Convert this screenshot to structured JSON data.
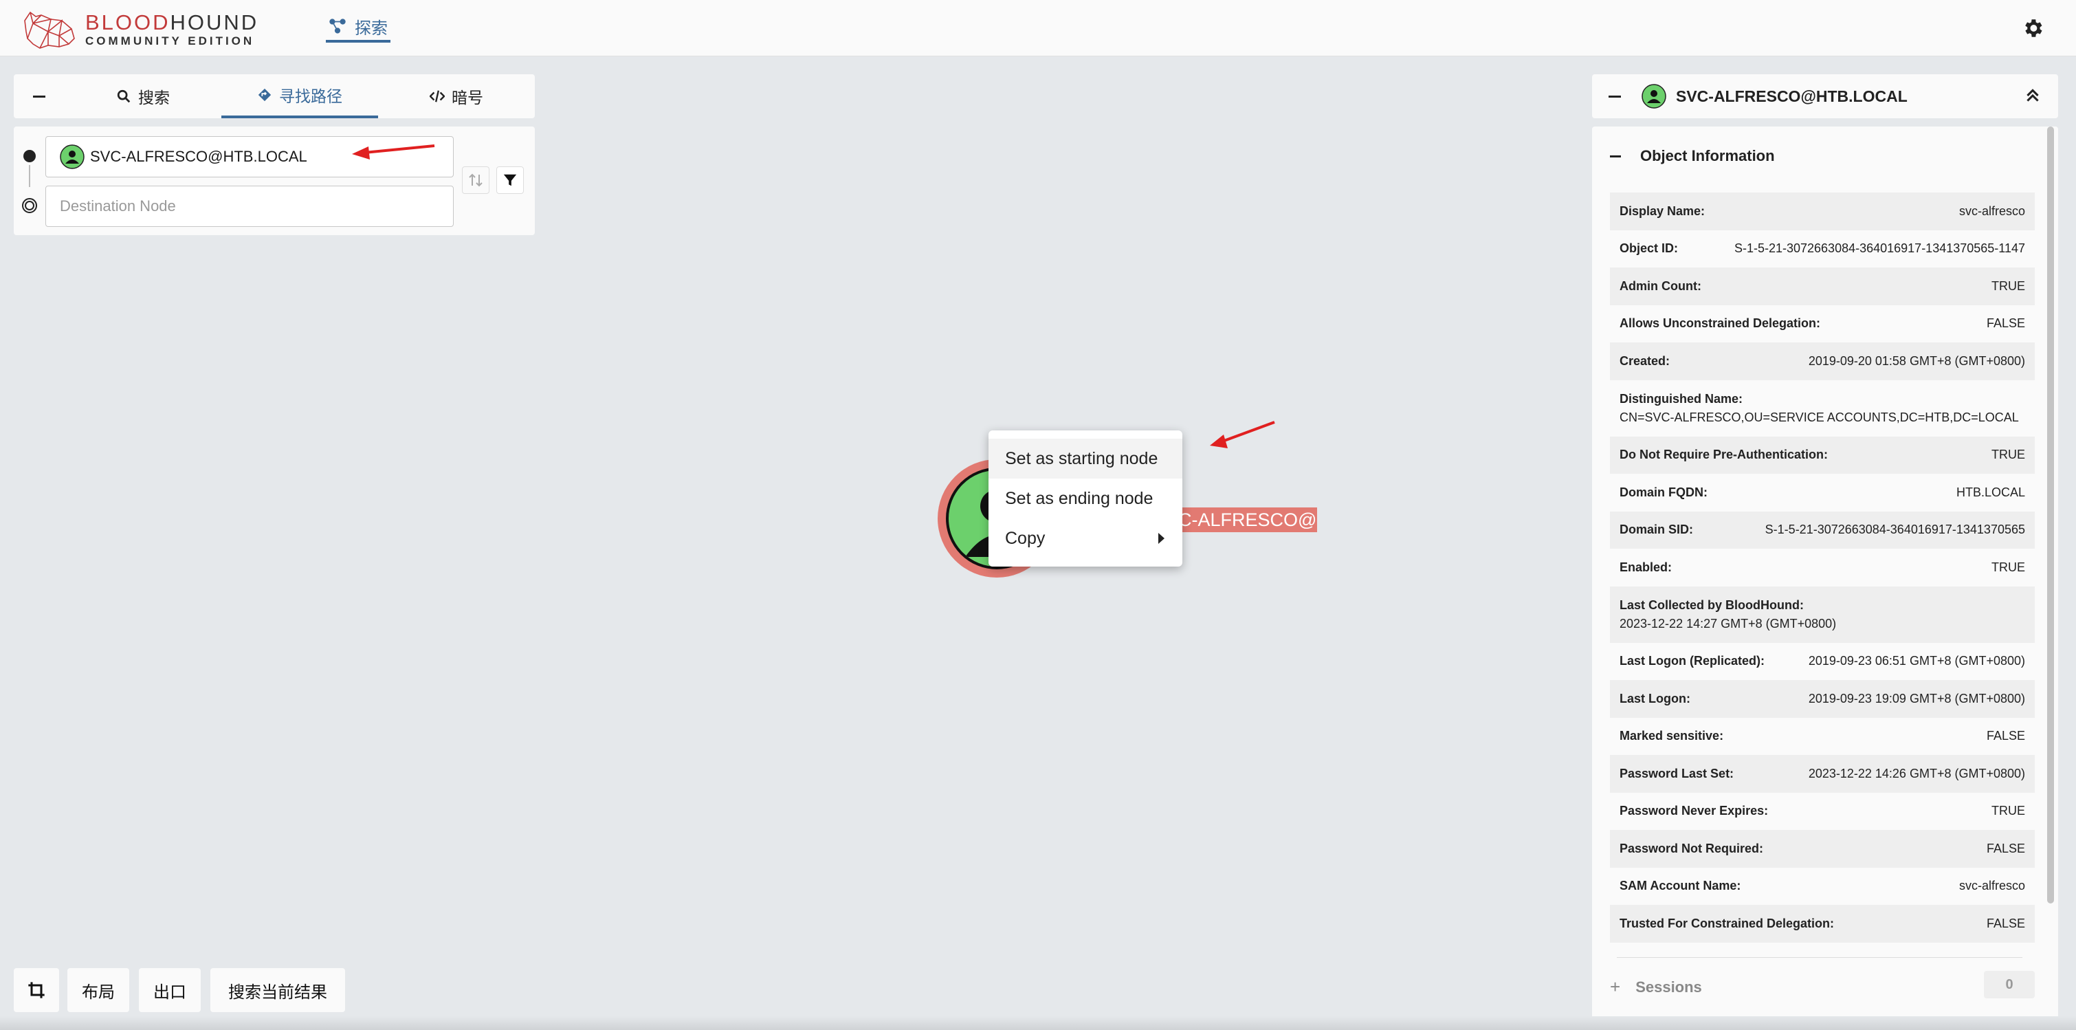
{
  "app": {
    "logo_title_a": "BLOOD",
    "logo_title_b": "HOUND",
    "logo_subtitle": "COMMUNITY EDITION",
    "nav_explore": "探索",
    "settings_icon": "gear-icon"
  },
  "search_panel": {
    "tabs": [
      {
        "label": "搜索",
        "icon": "search-icon"
      },
      {
        "label": "寻找路径",
        "icon": "path-icon"
      },
      {
        "label": "暗号",
        "icon": "code-icon"
      }
    ],
    "start_node_value": "SVC-ALFRESCO@HTB.LOCAL",
    "destination_placeholder": "Destination Node"
  },
  "bottom_toolbar": {
    "layout": "布局",
    "export": "出口",
    "search_current": "搜索当前结果"
  },
  "graph": {
    "node_label": "SVC-ALFRESCO@HTB.LOCAL",
    "node_label_visible": "O@HTB.LOCAL",
    "node_color": "#6cd06c",
    "node_ring_color": "#e27a72"
  },
  "context_menu": {
    "items": [
      "Set as starting node",
      "Set as ending node",
      "Copy"
    ]
  },
  "entity_panel": {
    "title": "SVC-ALFRESCO@HTB.LOCAL",
    "section": "Object Information",
    "properties": [
      {
        "key": "Display Name:",
        "value": "svc-alfresco"
      },
      {
        "key": "Object ID:",
        "value": "S-1-5-21-3072663084-364016917-1341370565-1147"
      },
      {
        "key": "Admin Count:",
        "value": "TRUE"
      },
      {
        "key": "Allows Unconstrained Delegation:",
        "value": "FALSE"
      },
      {
        "key": "Created:",
        "value": "2019-09-20 01:58 GMT+8 (GMT+0800)"
      },
      {
        "key": "Distinguished Name:",
        "value": "CN=SVC-ALFRESCO,OU=SERVICE ACCOUNTS,DC=HTB,DC=LOCAL"
      },
      {
        "key": "Do Not Require Pre-Authentication:",
        "value": "TRUE"
      },
      {
        "key": "Domain FQDN:",
        "value": "HTB.LOCAL"
      },
      {
        "key": "Domain SID:",
        "value": "S-1-5-21-3072663084-364016917-1341370565"
      },
      {
        "key": "Enabled:",
        "value": "TRUE"
      },
      {
        "key": "Last Collected by BloodHound:",
        "value": "2023-12-22 14:27 GMT+8 (GMT+0800)"
      },
      {
        "key": "Last Logon (Replicated):",
        "value": "2019-09-23 06:51 GMT+8 (GMT+0800)"
      },
      {
        "key": "Last Logon:",
        "value": "2019-09-23 19:09 GMT+8 (GMT+0800)"
      },
      {
        "key": "Marked sensitive:",
        "value": "FALSE"
      },
      {
        "key": "Password Last Set:",
        "value": "2023-12-22 14:26 GMT+8 (GMT+0800)"
      },
      {
        "key": "Password Never Expires:",
        "value": "TRUE"
      },
      {
        "key": "Password Not Required:",
        "value": "FALSE"
      },
      {
        "key": "SAM Account Name:",
        "value": "svc-alfresco"
      },
      {
        "key": "Trusted For Constrained Delegation:",
        "value": "FALSE"
      }
    ],
    "sessions_label": "Sessions",
    "sessions_count": "0"
  }
}
